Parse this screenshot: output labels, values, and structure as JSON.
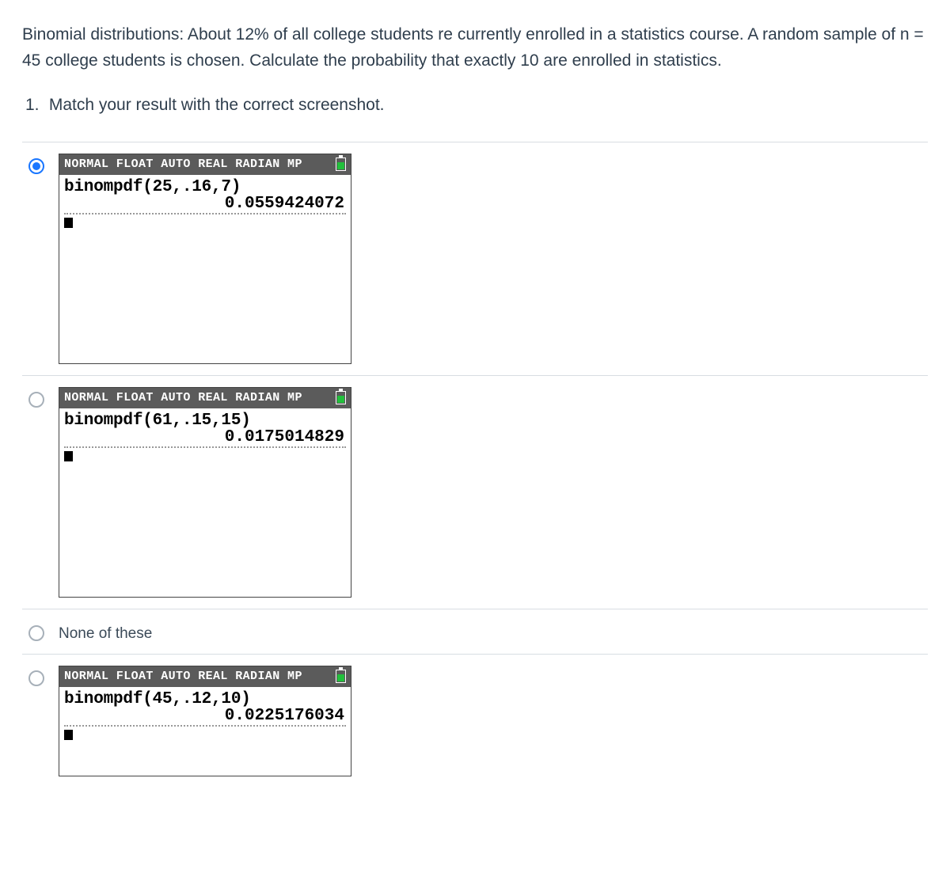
{
  "question": {
    "intro": "Binomial distributions:  About 12% of all college students re currently enrolled in a statistics course.  A random sample of n = 45 college students is chosen.  Calculate the probability that exactly 10 are enrolled in statistics.",
    "sub_number": "1.",
    "sub_text": "Match your result with the correct screenshot."
  },
  "calc_header": "NORMAL FLOAT AUTO REAL RADIAN MP",
  "options": [
    {
      "type": "calc",
      "selected": true,
      "tall": true,
      "cmd": "binompdf(25,.16,7)",
      "result": "0.0559424072"
    },
    {
      "type": "calc",
      "selected": false,
      "tall": true,
      "cmd": "binompdf(61,.15,15)",
      "result": "0.0175014829"
    },
    {
      "type": "text",
      "selected": false,
      "label": "None of these"
    },
    {
      "type": "calc",
      "selected": false,
      "tall": false,
      "cmd": "binompdf(45,.12,10)",
      "result": "0.0225176034"
    }
  ]
}
